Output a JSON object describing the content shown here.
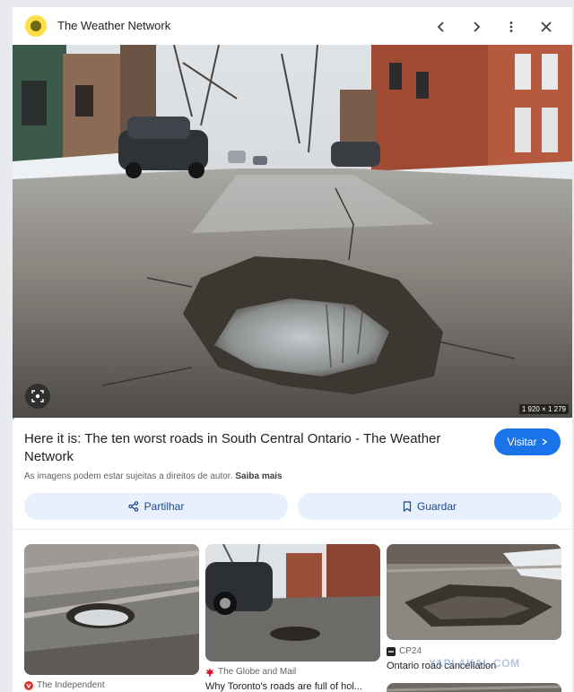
{
  "header": {
    "site_name": "The Weather Network",
    "prev_icon": "chevron-left-icon",
    "next_icon": "chevron-right-icon",
    "more_icon": "more-vert-icon",
    "close_icon": "close-icon"
  },
  "main_image": {
    "dimensions": "1 920 × 1 279",
    "lens_icon": "lens-icon"
  },
  "result": {
    "title": "Here it is: The ten worst roads in South Central Ontario - The Weather Network",
    "visit_label": "Visitar",
    "rights_text": "As imagens podem estar sujeitas a direitos de autor.",
    "rights_link": "Saiba mais",
    "share_label": "Partilhar",
    "save_label": "Guardar"
  },
  "related": [
    {
      "source": "The Independent",
      "caption": ""
    },
    {
      "source": "The Globe and Mail",
      "caption": "Why Toronto's roads are full of hol..."
    },
    {
      "source": "CP24",
      "caption": "Ontario road cancellation"
    }
  ],
  "watermark": "YAPLAKAL.COM",
  "colors": {
    "accent": "#1a73e8",
    "chip_bg": "#e8f0fe"
  }
}
